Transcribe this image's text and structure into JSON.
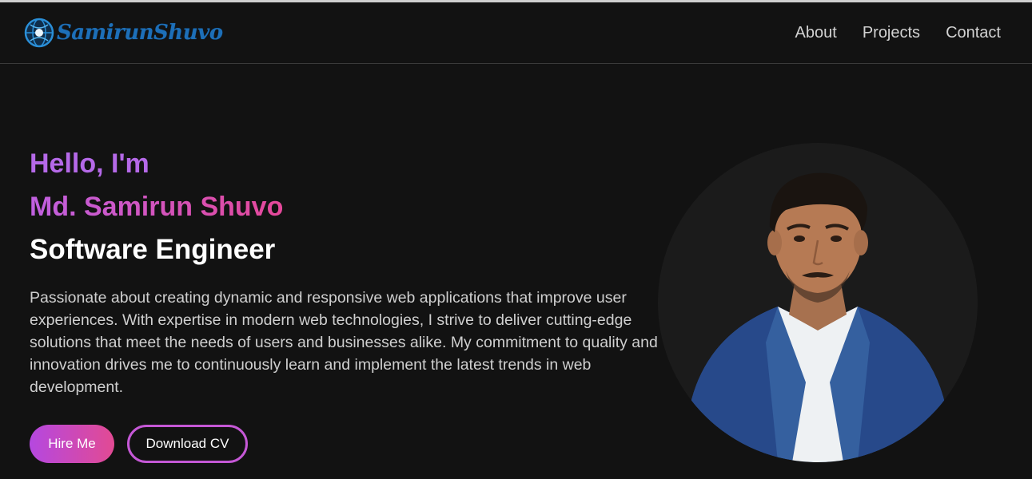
{
  "brand": {
    "logo_text": "SamirunShuvo"
  },
  "nav": {
    "items": [
      {
        "label": "About"
      },
      {
        "label": "Projects"
      },
      {
        "label": "Contact"
      }
    ]
  },
  "hero": {
    "greeting": "Hello, I'm",
    "name": "Md. Samirun Shuvo",
    "role": "Software Engineer",
    "description": "Passionate about creating dynamic and responsive web applications that improve user experiences. With expertise in modern web technologies, I strive to deliver cutting-edge solutions that meet the needs of users and businesses alike. My commitment to quality and innovation drives me to continuously learn and implement the latest trends in web development.",
    "primary_button": "Hire Me",
    "secondary_button": "Download CV"
  },
  "colors": {
    "background": "#121212",
    "accent_purple": "#b569e8",
    "accent_pink": "#e5489a",
    "logo_blue": "#1d6fb8"
  },
  "icons": {
    "logo": "globe-logo-icon",
    "avatar": "profile-photo"
  }
}
